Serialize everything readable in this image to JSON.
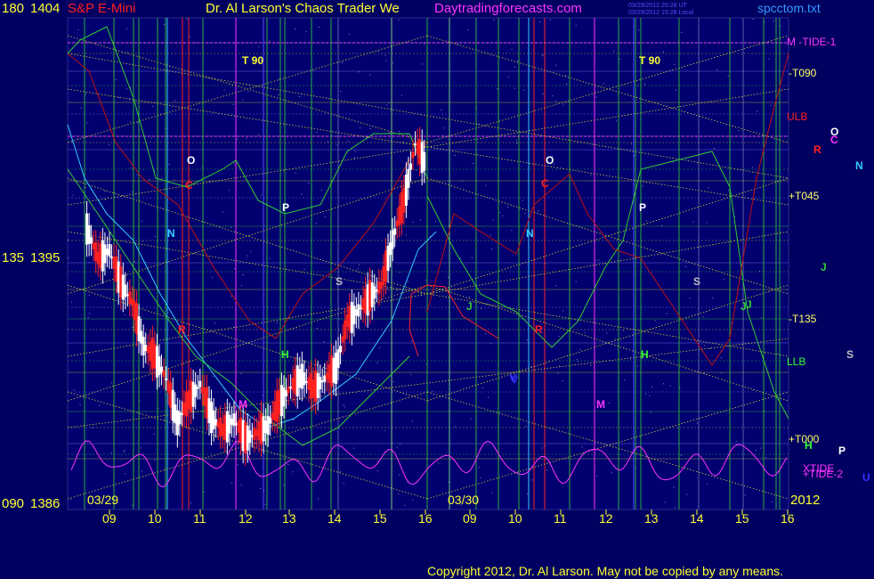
{
  "header": {
    "left_value": "180",
    "left_price": "1404",
    "symbol": "S&P E-Mini",
    "title": "Dr. Al Larson's Chaos Trader We",
    "website": "Daytradingforecasts.com",
    "timestamp1": "03/29/2012 20:28 UT",
    "timestamp2": "03/29/2012 15:28 Local",
    "file": "spcctom.txt"
  },
  "left_axis": [
    {
      "value": "180",
      "price": "1404"
    },
    {
      "value": "135",
      "price": "1395"
    },
    {
      "value": "090",
      "price": "1386"
    }
  ],
  "time_axis": {
    "ticks": [
      "09",
      "10",
      "11",
      "12",
      "13",
      "14",
      "15",
      "16",
      "09",
      "10",
      "11",
      "12",
      "13",
      "14",
      "15",
      "16"
    ],
    "date_labels": [
      "03/29",
      "03/30"
    ],
    "year": "2012"
  },
  "right_labels": [
    {
      "text": "M  -TIDE-1",
      "color": "#ff33ff"
    },
    {
      "text": "-T090",
      "color": "#ffff66"
    },
    {
      "text": "ULB",
      "color": "#ff2020"
    },
    {
      "text": "+T045",
      "color": "#ffff66"
    },
    {
      "text": "-T135",
      "color": "#ffff66"
    },
    {
      "text": "LLB",
      "color": "#33ff33"
    },
    {
      "text": "+T000",
      "color": "#ffff66"
    },
    {
      "text": "XTIDE",
      "color": "#ff33ff"
    },
    {
      "text": "+TIDE-2",
      "color": "#ff33ff"
    }
  ],
  "side_letters": [
    {
      "text": "O",
      "color": "#ffffff"
    },
    {
      "text": "C",
      "color": "#ff33ff"
    },
    {
      "text": "R",
      "color": "#ff2020"
    },
    {
      "text": "N",
      "color": "#33ccff"
    },
    {
      "text": "J",
      "color": "#33cc33"
    },
    {
      "text": "S",
      "color": "#c0c0c0"
    },
    {
      "text": "H",
      "color": "#33ff33"
    },
    {
      "text": "P",
      "color": "#ffffff"
    },
    {
      "text": "U",
      "color": "#3333ff"
    }
  ],
  "chart_letters": [
    {
      "text": "T  90",
      "color": "#ffff33"
    },
    {
      "text": "O",
      "color": "#ffffff"
    },
    {
      "text": "C",
      "color": "#ff2020"
    },
    {
      "text": "N",
      "color": "#33ccff"
    },
    {
      "text": "P",
      "color": "#ffffff"
    },
    {
      "text": "S",
      "color": "#c0c0c0"
    },
    {
      "text": "R",
      "color": "#ff2020"
    },
    {
      "text": "H",
      "color": "#33ff33"
    },
    {
      "text": "M",
      "color": "#ff33ff"
    },
    {
      "text": "J",
      "color": "#33cc33"
    },
    {
      "text": "V",
      "color": "#3333ff"
    },
    {
      "text": "T  90",
      "color": "#ffff33"
    },
    {
      "text": "O",
      "color": "#ffffff"
    },
    {
      "text": "C",
      "color": "#ff2020"
    },
    {
      "text": "N",
      "color": "#33ccff"
    },
    {
      "text": "J",
      "color": "#33cc33"
    },
    {
      "text": "R",
      "color": "#ff2020"
    },
    {
      "text": "V",
      "color": "#3333ff"
    },
    {
      "text": "M",
      "color": "#ff33ff"
    },
    {
      "text": "P",
      "color": "#ffffff"
    },
    {
      "text": "S",
      "color": "#c0c0c0"
    },
    {
      "text": "H",
      "color": "#33ff33"
    },
    {
      "text": "J",
      "color": "#33cc33"
    }
  ],
  "copyright": "Copyright 2012, Dr. Al Larson. May not be copied by any means.",
  "colors": {
    "background": "#000060",
    "price_up": "#ffffff",
    "price_down": "#ff2020",
    "grid_green": "#33cc33",
    "grid_yellow": "#cccc33",
    "axis_text": "#ffff33"
  },
  "chart_data": {
    "type": "bar",
    "title": "S&P E-Mini",
    "ylim": [
      1386,
      1404
    ],
    "xlim": [
      "03/29 08:30",
      "03/30 16:00"
    ],
    "price_path": [
      {
        "t": "03/29 08:30",
        "p": 1396.3
      },
      {
        "t": "03/29 08:45",
        "p": 1395.2
      },
      {
        "t": "03/29 09:00",
        "p": 1395.5
      },
      {
        "t": "03/29 09:15",
        "p": 1394.3
      },
      {
        "t": "03/29 09:30",
        "p": 1393.6
      },
      {
        "t": "03/29 09:45",
        "p": 1392.0
      },
      {
        "t": "03/29 10:00",
        "p": 1391.6
      },
      {
        "t": "03/29 10:15",
        "p": 1390.8
      },
      {
        "t": "03/29 10:30",
        "p": 1389.2
      },
      {
        "t": "03/29 10:45",
        "p": 1390.0
      },
      {
        "t": "03/29 11:00",
        "p": 1390.6
      },
      {
        "t": "03/29 11:15",
        "p": 1389.4
      },
      {
        "t": "03/29 11:30",
        "p": 1388.9
      },
      {
        "t": "03/29 11:45",
        "p": 1389.3
      },
      {
        "t": "03/29 12:00",
        "p": 1388.6
      },
      {
        "t": "03/29 12:15",
        "p": 1388.8
      },
      {
        "t": "03/29 12:30",
        "p": 1389.1
      },
      {
        "t": "03/29 12:45",
        "p": 1389.9
      },
      {
        "t": "03/29 13:00",
        "p": 1390.5
      },
      {
        "t": "03/29 13:15",
        "p": 1390.9
      },
      {
        "t": "03/29 13:30",
        "p": 1390.4
      },
      {
        "t": "03/29 13:45",
        "p": 1390.8
      },
      {
        "t": "03/29 14:00",
        "p": 1391.2
      },
      {
        "t": "03/29 14:15",
        "p": 1392.9
      },
      {
        "t": "03/29 14:30",
        "p": 1393.3
      },
      {
        "t": "03/29 14:45",
        "p": 1393.8
      },
      {
        "t": "03/29 15:00",
        "p": 1394.2
      },
      {
        "t": "03/29 15:15",
        "p": 1395.9
      },
      {
        "t": "03/29 15:30",
        "p": 1397.3
      },
      {
        "t": "03/29 15:45",
        "p": 1399.4
      },
      {
        "t": "03/29 16:00",
        "p": 1398.6
      }
    ],
    "volatility_band_upper": [
      1403.2,
      1401.0,
      1399.5,
      1397.8,
      1397.0,
      1396.5,
      1396.0,
      1395.8,
      1395.0,
      1394.8,
      1395.5,
      1396.6,
      1398.0,
      1399.3,
      1400.0
    ],
    "volatility_band_lower": [
      1395.0,
      1394.0,
      1393.0,
      1392.0,
      1391.0,
      1390.2,
      1389.2,
      1388.6,
      1388.5,
      1389.5,
      1390.5,
      1391.5,
      1392.5,
      1394.0,
      1396.0
    ],
    "oscillator_range": [
      1387.0,
      1389.0
    ]
  }
}
